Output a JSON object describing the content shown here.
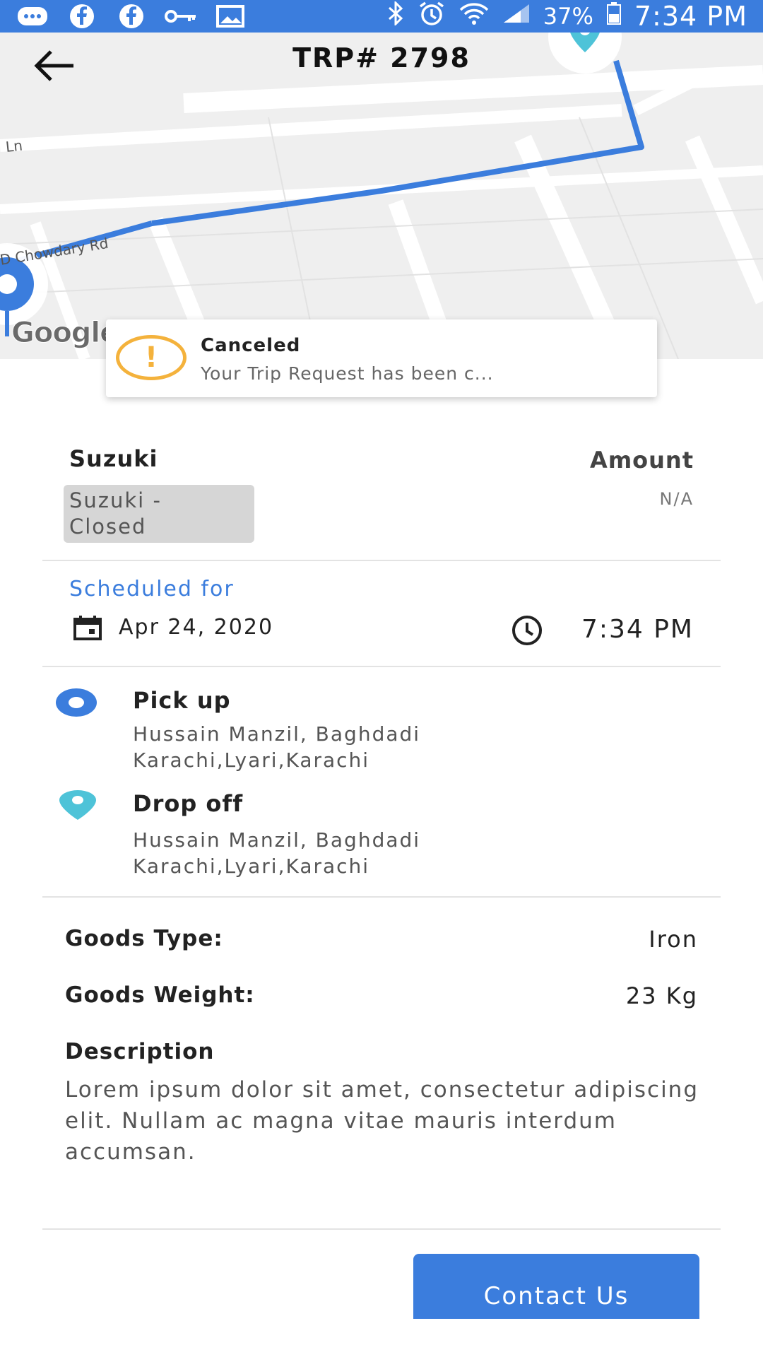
{
  "status_bar": {
    "battery": "37%",
    "time": "7:34 PM",
    "icons": [
      "messages-icon",
      "facebook-icon",
      "facebook-icon",
      "key-icon",
      "image-icon",
      "bluetooth-icon",
      "alarm-icon",
      "wifi-icon",
      "signal-icon",
      "battery-icon"
    ]
  },
  "header": {
    "title": "TRP# 2798",
    "back_icon": "arrow-back-icon"
  },
  "map": {
    "road_label_1": "Ln",
    "road_label_2": "D Chowdary Rd",
    "attribution": "Google",
    "route_color": "#3b7ddd",
    "dropoff_pin_color": "#4ec3d8"
  },
  "toast": {
    "title": "Canceled",
    "message": "Your Trip Request has been c...",
    "icon": "warning-icon",
    "icon_color": "#f4b23c"
  },
  "vehicle": {
    "name": "Suzuki",
    "status_line1": "Suzuki -",
    "status_line2": "Closed"
  },
  "amount": {
    "label": "Amount",
    "value": "N/A"
  },
  "schedule": {
    "label": "Scheduled for",
    "date": "Apr 24, 2020",
    "time": "7:34 PM"
  },
  "pickup": {
    "title": "Pick up",
    "address_line1": "Hussain Manzil, Baghdadi",
    "address_line2": "Karachi,Lyari,Karachi"
  },
  "dropoff": {
    "title": "Drop off",
    "address_line1": "Hussain Manzil, Baghdadi",
    "address_line2": "Karachi,Lyari,Karachi"
  },
  "goods": {
    "type_label": "Goods Type:",
    "type_value": "Iron",
    "weight_label": "Goods Weight:",
    "weight_value": "23 Kg"
  },
  "description": {
    "label": "Description",
    "text": "Lorem ipsum dolor sit amet, consectetur adipiscing elit. Nullam ac magna vitae mauris interdum accumsan."
  },
  "actions": {
    "contact_label": "Contact Us"
  },
  "colors": {
    "accent": "#3b7ddd",
    "chip_bg": "#d6d6d6"
  }
}
